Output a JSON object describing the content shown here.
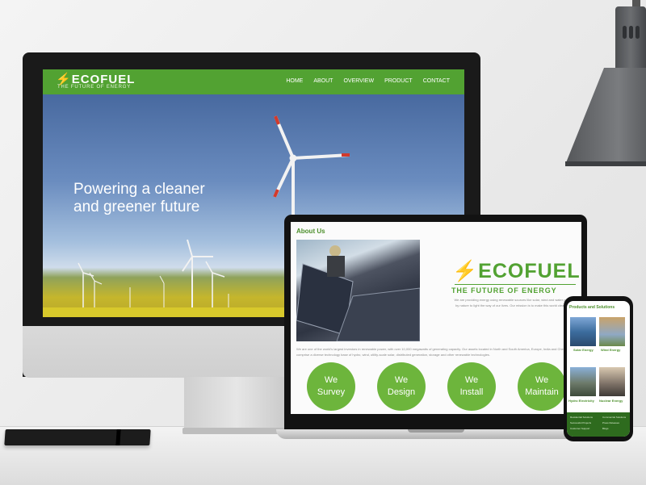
{
  "monitor_site": {
    "logo": "ECOFUEL",
    "tagline": "THE FUTURE OF ENERGY",
    "nav": [
      "HOME",
      "ABOUT",
      "OVERVIEW",
      "PRODUCT",
      "CONTACT"
    ],
    "hero_line1": "Powering a cleaner",
    "hero_line2": "and greener future"
  },
  "laptop_site": {
    "section_title": "About Us",
    "logo": "ECOFUEL",
    "tagline": "THE FUTURE OF ENERGY",
    "description": "We are providing energy using renewable sources like solar, wind and water provided by nature to light the way of our lives. Our mission is to make this world cleaner too.",
    "paragraph": "We are one of the world's largest investors in renewable power, with over 10,000 megawatts of generating capacity. Our assets located in North and South America, Europe, India and China comprise a diverse technology base of hydro, wind, utility-scale solar, distributed generation, storage and other renewable technologies.",
    "services": [
      {
        "line1": "We",
        "line2": "Survey"
      },
      {
        "line1": "We",
        "line2": "Design"
      },
      {
        "line1": "We",
        "line2": "Install"
      },
      {
        "line1": "We",
        "line2": "Maintain"
      }
    ]
  },
  "phone_site": {
    "title": "Products and Solutions",
    "products": [
      "Solar Energy",
      "Wind Energy",
      "Hydro Electricity",
      "Nuclear Energy"
    ],
    "footer_links": [
      "Residential Solutions",
      "Commercial Solutions",
      "Successful Projects",
      "Press Releases",
      "Customer Support",
      "Blogs"
    ]
  }
}
